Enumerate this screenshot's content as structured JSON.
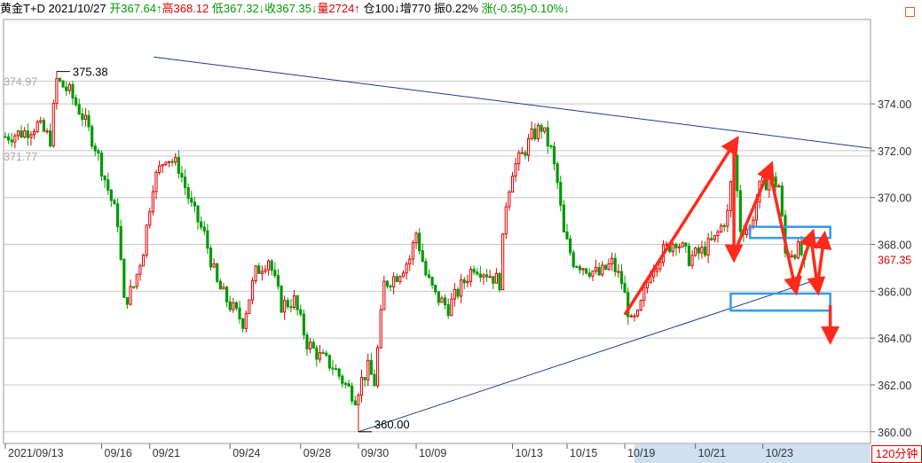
{
  "header": {
    "name": "黄金T+D",
    "date": "2021/10/27",
    "open": "开367.64↑",
    "high": "高368.12",
    "low": "低367.32↓",
    "close": "收367.35↓",
    "volume": "量2724↑",
    "position": "仓100↓",
    "increase": "增770",
    "amplitude": "振0.22%",
    "change": "涨(-0.35)-0.10%↓"
  },
  "period_label": "120分钟",
  "colors": {
    "up": "#e00000",
    "down": "#009900",
    "trendline": "#1a3c8c",
    "annotation": "#ff2a1a",
    "box": "#3399ee"
  },
  "chart_data": {
    "type": "candlestick",
    "ylim": [
      359.5,
      377.6
    ],
    "yticks": [
      {
        "value": 374,
        "label": "374.00"
      },
      {
        "value": 372,
        "label": "372.00"
      },
      {
        "value": 370,
        "label": "370.00"
      },
      {
        "value": 368,
        "label": "368.00"
      },
      {
        "value": 366,
        "label": "366.00"
      },
      {
        "value": 364,
        "label": "364.00"
      },
      {
        "value": 362,
        "label": "362.00"
      },
      {
        "value": 360,
        "label": "360.00"
      }
    ],
    "left_ticks": [
      {
        "value": 374.97,
        "label": "374.97"
      },
      {
        "value": 371.77,
        "label": "371.77"
      }
    ],
    "xticks": [
      {
        "index": 0,
        "label": "2021/09/13"
      },
      {
        "index": 30,
        "label": "09/16"
      },
      {
        "index": 45,
        "label": "09/21"
      },
      {
        "index": 70,
        "label": "09/24"
      },
      {
        "index": 92,
        "label": "09/28"
      },
      {
        "index": 110,
        "label": "09/30"
      },
      {
        "index": 128,
        "label": "10/09"
      },
      {
        "index": 158,
        "label": "10/13"
      },
      {
        "index": 175,
        "label": "10/15"
      },
      {
        "index": 193,
        "label": "10/19"
      },
      {
        "index": 215,
        "label": "10/21"
      },
      {
        "index": 236,
        "label": "10/23"
      }
    ],
    "max_label": {
      "index": 16,
      "value": 375.38,
      "label": "375.38"
    },
    "min_label": {
      "index": 110,
      "value": 360.0,
      "label": "360.00"
    },
    "last_price": {
      "value": 367.35,
      "label": "367.35"
    },
    "waypoints": [
      [
        0,
        372.6
      ],
      [
        6,
        372.8
      ],
      [
        10,
        373.1
      ],
      [
        14,
        372.5
      ],
      [
        16,
        375.0
      ],
      [
        20,
        374.5
      ],
      [
        24,
        373.5
      ],
      [
        28,
        372.2
      ],
      [
        31,
        370.8
      ],
      [
        35,
        369.0
      ],
      [
        37,
        365.5
      ],
      [
        40,
        366.2
      ],
      [
        43,
        367.8
      ],
      [
        46,
        370.6
      ],
      [
        50,
        371.8
      ],
      [
        54,
        371.3
      ],
      [
        58,
        369.6
      ],
      [
        62,
        368.4
      ],
      [
        66,
        366.3
      ],
      [
        70,
        365.4
      ],
      [
        74,
        364.7
      ],
      [
        78,
        366.8
      ],
      [
        82,
        367.4
      ],
      [
        86,
        365.4
      ],
      [
        90,
        365.6
      ],
      [
        94,
        363.8
      ],
      [
        98,
        363.2
      ],
      [
        102,
        362.8
      ],
      [
        106,
        362.0
      ],
      [
        109,
        361.5
      ],
      [
        111,
        362.2
      ],
      [
        113,
        362.7
      ],
      [
        115,
        362.1
      ],
      [
        118,
        366.3
      ],
      [
        122,
        366.7
      ],
      [
        126,
        367.4
      ],
      [
        128,
        368.5
      ],
      [
        131,
        366.7
      ],
      [
        134,
        365.8
      ],
      [
        138,
        365.3
      ],
      [
        142,
        366.2
      ],
      [
        146,
        367.1
      ],
      [
        150,
        366.8
      ],
      [
        154,
        366.4
      ],
      [
        156,
        369.8
      ],
      [
        158,
        371.2
      ],
      [
        161,
        371.8
      ],
      [
        164,
        372.6
      ],
      [
        167,
        373.0
      ],
      [
        170,
        372.0
      ],
      [
        172,
        370.6
      ],
      [
        174,
        368.4
      ],
      [
        177,
        367.3
      ],
      [
        181,
        367.0
      ],
      [
        185,
        366.7
      ],
      [
        189,
        367.2
      ],
      [
        192,
        366.4
      ],
      [
        195,
        364.6
      ],
      [
        197,
        364.9
      ],
      [
        201,
        366.9
      ],
      [
        205,
        367.7
      ],
      [
        209,
        368.2
      ],
      [
        213,
        367.4
      ],
      [
        217,
        367.7
      ],
      [
        221,
        368.2
      ],
      [
        225,
        369.3
      ],
      [
        227,
        371.8
      ],
      [
        229,
        368.7
      ],
      [
        232,
        368.7
      ],
      [
        235,
        370.4
      ],
      [
        238,
        370.8
      ],
      [
        241,
        370.5
      ],
      [
        243,
        367.6
      ],
      [
        247,
        367.8
      ],
      [
        249,
        367.35
      ]
    ]
  },
  "annotations": {
    "upper_trendline": {
      "from": [
        2,
        376.0
      ],
      "to": [
        270,
        372.1
      ]
    },
    "lower_trendline": {
      "from": [
        110,
        360.0
      ],
      "to": [
        253,
        366.5
      ]
    },
    "boxes": [
      {
        "x1": 232,
        "x2": 257,
        "y1": 368.75,
        "y2": 368.5
      },
      {
        "x1": 226,
        "x2": 257,
        "y1": 365.9,
        "y2": 365.4
      }
    ],
    "arrows": [
      [
        [
          193,
          365.0
        ],
        [
          227,
          372.3
        ]
      ],
      [
        [
          227,
          372.3
        ],
        [
          227,
          367.6
        ]
      ],
      [
        [
          227,
          367.6
        ],
        [
          238,
          371.2
        ]
      ],
      [
        [
          238,
          371.2
        ],
        [
          246,
          366.2
        ]
      ],
      [
        [
          246,
          366.2
        ],
        [
          251,
          368.3
        ]
      ],
      [
        [
          251,
          368.3
        ],
        [
          253,
          366.2
        ]
      ],
      [
        [
          253,
          366.2
        ],
        [
          255,
          368.2
        ]
      ],
      [
        [
          257,
          365.4
        ],
        [
          257,
          364.1
        ]
      ]
    ]
  }
}
